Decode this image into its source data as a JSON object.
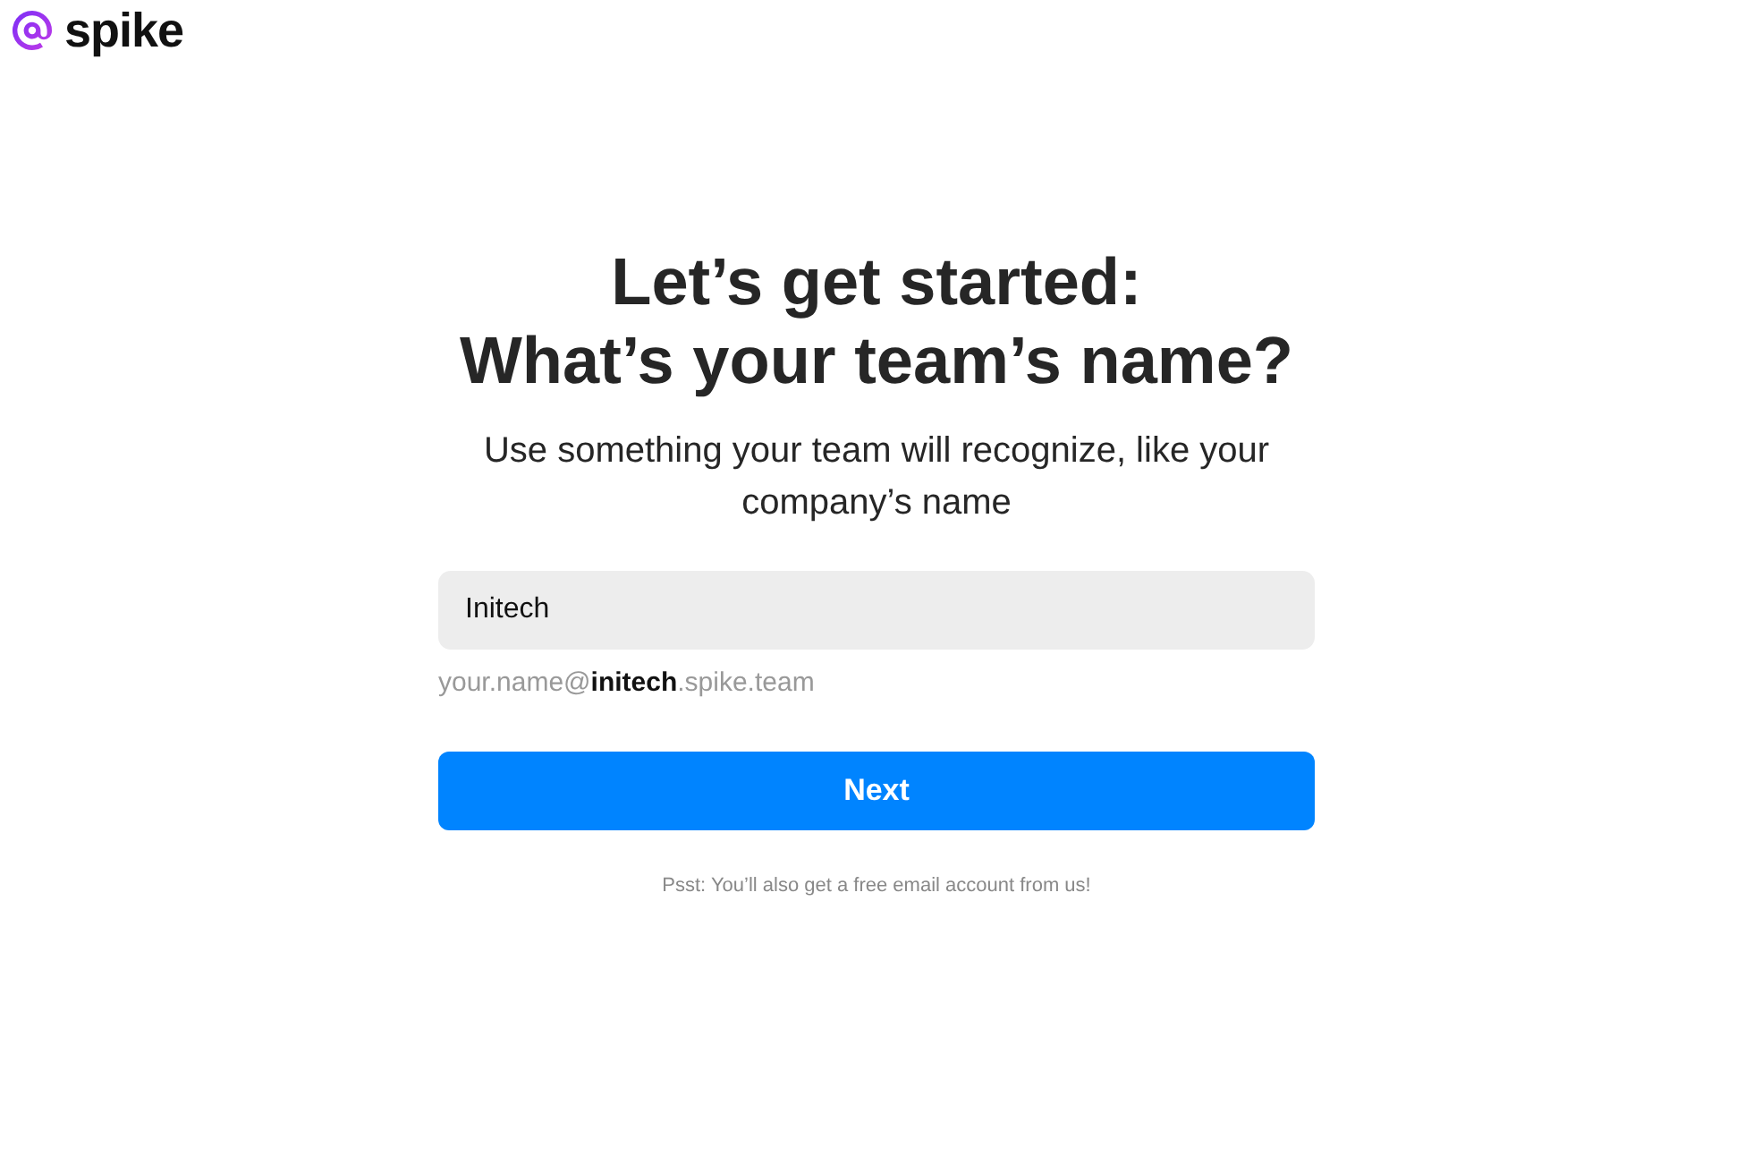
{
  "logo": {
    "text": "spike"
  },
  "title_lines": [
    "Let’s get started:",
    "What’s your team’s name?"
  ],
  "subtitle": "Use something your team will recognize, like your company’s name",
  "team_field": {
    "value": "Initech"
  },
  "address_hint": "your.name@**initech**.spike.team",
  "next_button": {
    "label": "Next"
  },
  "footnote": "Psst: You’ll also get a free email account from us!"
}
